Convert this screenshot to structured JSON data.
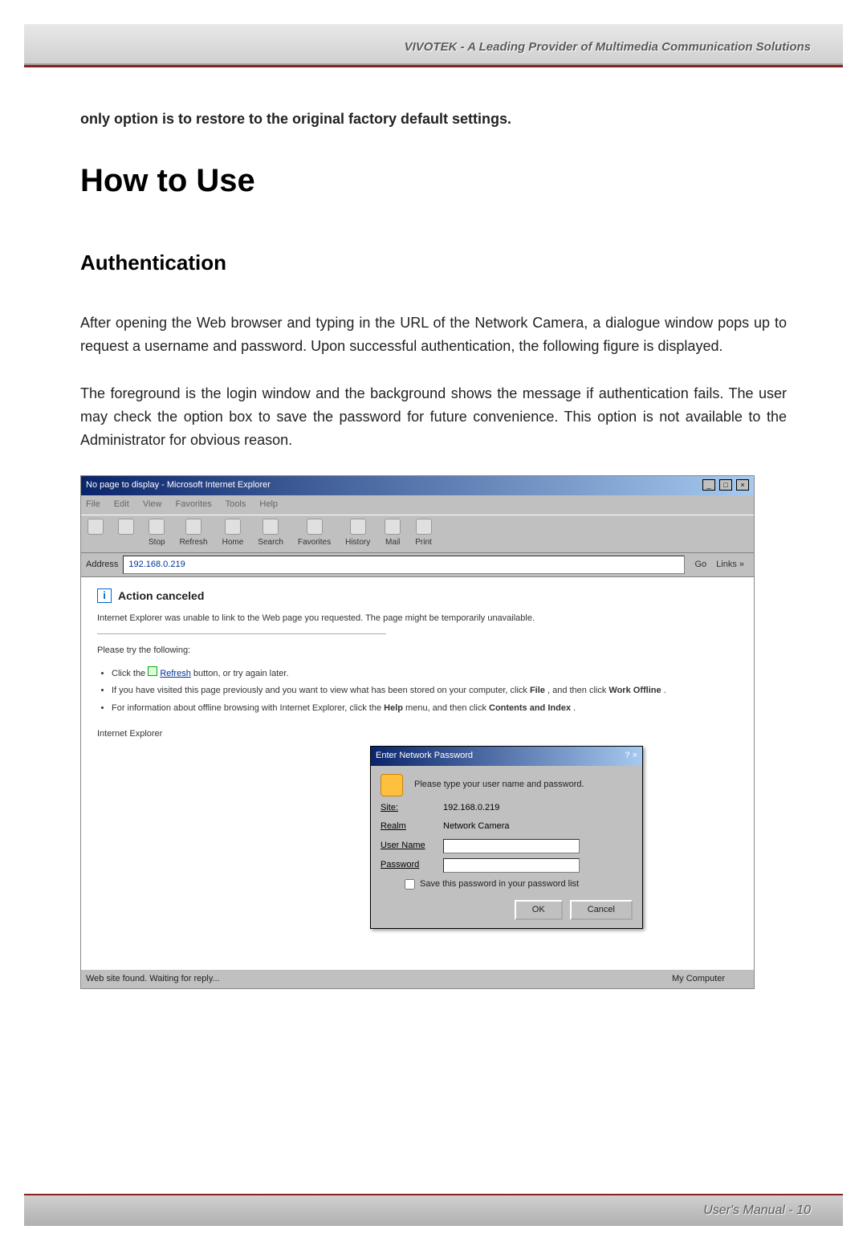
{
  "header": {
    "tagline": "VIVOTEK - A Leading Provider of Multimedia Communication Solutions"
  },
  "body": {
    "bold_intro": "only option is to restore to the original factory default settings.",
    "h1": "How to Use",
    "h2": "Authentication",
    "p1": "After opening the Web browser and typing in the URL of the Network Camera, a dialogue window pops up to request a username and password. Upon successful authentication, the following figure is displayed.",
    "p2": "The foreground is the login window and the background shows the message if authentication fails. The user may check the option box to save the password for future convenience.  This option is not available to the Administrator for obvious reason."
  },
  "ie": {
    "title": "No page to display - Microsoft Internet Explorer",
    "menu": {
      "file": "File",
      "edit": "Edit",
      "view": "View",
      "favorites": "Favorites",
      "tools": "Tools",
      "help": "Help"
    },
    "toolbar": {
      "back": "Back",
      "forward": "Forward",
      "stop": "Stop",
      "refresh": "Refresh",
      "home": "Home",
      "search": "Search",
      "favorites": "Favorites",
      "history": "History",
      "mail": "Mail",
      "print": "Print"
    },
    "address_label": "Address",
    "address_value": "192.168.0.219",
    "go": "Go",
    "links": "Links »",
    "cancelled_heading": "Action canceled",
    "cancelled_text": "Internet Explorer was unable to link to the Web page you requested. The page might be temporarily unavailable.",
    "try_following": "Please try the following:",
    "bullet1_a": "Click the ",
    "bullet1_b": "Refresh",
    "bullet1_c": " button, or try again later.",
    "bullet2_a": "If you have visited this page previously and you want to view what has been stored on your computer, click ",
    "bullet2_b": "File",
    "bullet2_c": ", and then click ",
    "bullet2_d": "Work Offline",
    "bullet2_e": ".",
    "bullet3_a": "For information about offline browsing with Internet Explorer, click the ",
    "bullet3_b": "Help",
    "bullet3_c": " menu, and then click ",
    "bullet3_d": "Contents and Index",
    "bullet3_e": ".",
    "ie_label": "Internet Explorer",
    "dialog": {
      "title": "Enter Network Password",
      "instruction": "Please type your user name and password.",
      "site_label": "Site:",
      "site_value": "192.168.0.219",
      "realm_label": "Realm",
      "realm_value": "Network Camera",
      "user_label": "User Name",
      "pass_label": "Password",
      "save_check": "Save this password in your password list",
      "ok": "OK",
      "cancel": "Cancel"
    },
    "status_text": "Web site found. Waiting for reply...",
    "status_zone": "My Computer"
  },
  "footer": {
    "text": "User's Manual - 10"
  }
}
